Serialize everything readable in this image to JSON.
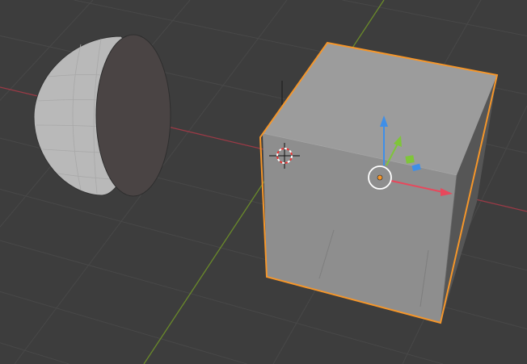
{
  "viewport": {
    "background_color": "#3d3d3d",
    "grid_color": "#484848",
    "x_axis_color": "#9a3a46",
    "y_axis_color": "#6a8a2a",
    "selection_outline_color": "#f5962a",
    "objects": [
      {
        "name": "Cube",
        "selected": true,
        "icon": "cube-mesh"
      },
      {
        "name": "Hemisphere",
        "selected": false,
        "icon": "sphere-mesh"
      }
    ],
    "gizmo": {
      "x_color": "#e8485c",
      "y_color": "#7fc53a",
      "z_color": "#3f8fe8"
    },
    "cursor": "3d-cursor-icon"
  }
}
